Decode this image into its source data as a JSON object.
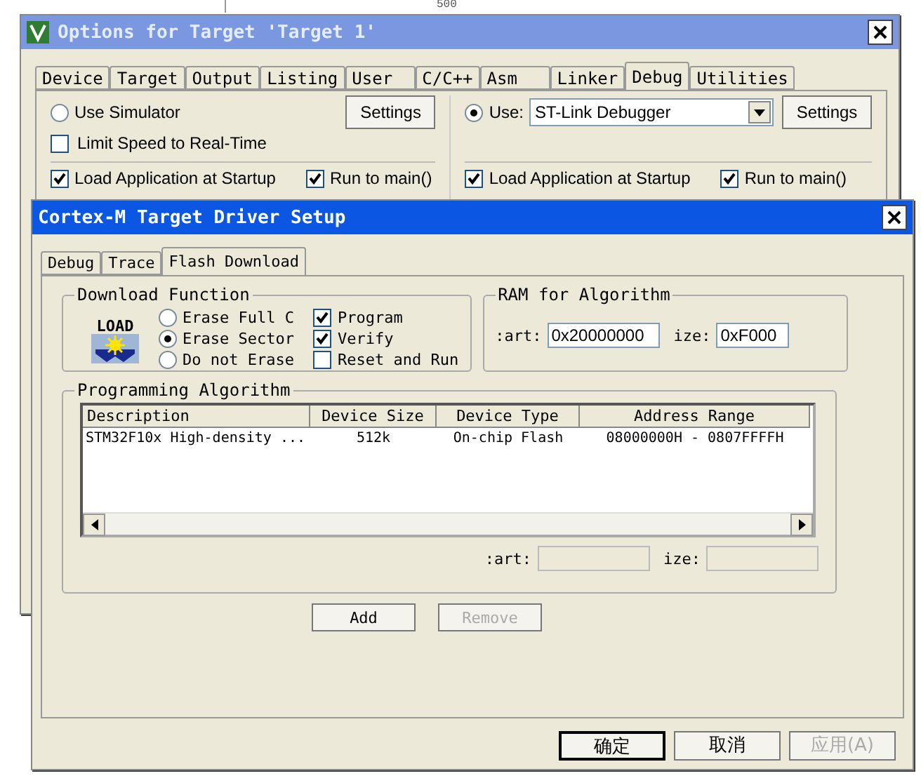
{
  "background_editor": {
    "line_number": "500"
  },
  "options_window": {
    "title": "Options for Target 'Target 1'",
    "tabs": [
      {
        "label": "Device",
        "selected": false
      },
      {
        "label": "Target",
        "selected": false
      },
      {
        "label": "Output",
        "selected": false
      },
      {
        "label": "Listing",
        "selected": false
      },
      {
        "label": "User",
        "selected": false
      },
      {
        "label": "C/C++",
        "selected": false
      },
      {
        "label": "Asm",
        "selected": false
      },
      {
        "label": "Linker",
        "selected": false
      },
      {
        "label": "Debug",
        "selected": true
      },
      {
        "label": "Utilities",
        "selected": false
      }
    ],
    "left": {
      "mode": {
        "label": "Use Simulator",
        "selected": false
      },
      "limit_speed": {
        "label": "Limit Speed to Real-Time",
        "checked": false
      },
      "settings_button": "Settings",
      "load_application": {
        "label": "Load Application at Startup",
        "checked": true
      },
      "run_to_main": {
        "label": "Run to main()",
        "checked": true
      }
    },
    "right": {
      "mode": {
        "label": "Use:",
        "selected": true
      },
      "debugger": "ST-Link Debugger",
      "settings_button": "Settings",
      "load_application": {
        "label": "Load Application at Startup",
        "checked": true
      },
      "run_to_main": {
        "label": "Run to main()",
        "checked": true
      }
    }
  },
  "driver_window": {
    "title": "Cortex-M Target Driver Setup",
    "tabs": [
      {
        "label": "Debug",
        "selected": false
      },
      {
        "label": "Trace",
        "selected": false
      },
      {
        "label": "Flash Download",
        "selected": true
      }
    ],
    "download_function": {
      "title": "Download Function",
      "icon_label": "LOAD",
      "erase_options": [
        {
          "label": "Erase Full C",
          "selected": false
        },
        {
          "label": "Erase Sector",
          "selected": true
        },
        {
          "label": "Do not Erase",
          "selected": false
        }
      ],
      "options": [
        {
          "label": "Program",
          "checked": true
        },
        {
          "label": "Verify",
          "checked": true
        },
        {
          "label": "Reset and Run",
          "checked": false
        }
      ]
    },
    "ram": {
      "title": "RAM for Algorithm",
      "start_label": ":art:",
      "start": "0x20000000",
      "size_label": "ize:",
      "size": "0xF000"
    },
    "algorithm": {
      "title": "Programming Algorithm",
      "columns": [
        "Description",
        "Device Size",
        "Device Type",
        "Address Range"
      ],
      "rows": [
        {
          "cells": [
            "STM32F10x High-density ...",
            "512k",
            "On-chip Flash",
            "08000000H - 0807FFFFH"
          ],
          "selected": false
        }
      ],
      "start_label": ":art:",
      "size_label": "ize:",
      "buttons": [
        {
          "label": "Add",
          "disabled": false
        },
        {
          "label": "Remove",
          "disabled": true
        }
      ]
    },
    "footer_buttons": [
      {
        "label": "确定",
        "default": true,
        "disabled": false
      },
      {
        "label": "取消",
        "default": false,
        "disabled": false
      },
      {
        "label": "应用(A)",
        "default": false,
        "disabled": true
      }
    ]
  }
}
